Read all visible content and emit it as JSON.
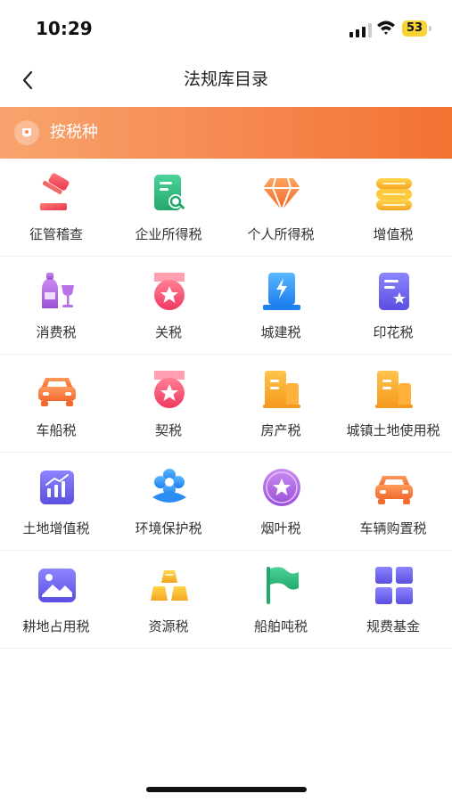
{
  "status": {
    "time": "10:29",
    "battery": "53"
  },
  "nav": {
    "title": "法规库目录"
  },
  "banner": {
    "label": "按税种"
  },
  "grid": {
    "items": [
      {
        "label": "征管稽查",
        "icon": "gavel-icon"
      },
      {
        "label": "企业所得税",
        "icon": "document-search-icon"
      },
      {
        "label": "个人所得税",
        "icon": "diamond-icon"
      },
      {
        "label": "增值税",
        "icon": "coin-stack-icon"
      },
      {
        "label": "消费税",
        "icon": "wine-bottle-icon"
      },
      {
        "label": "关税",
        "icon": "medal-icon"
      },
      {
        "label": "城建税",
        "icon": "building-lightning-icon"
      },
      {
        "label": "印花税",
        "icon": "stamp-document-icon"
      },
      {
        "label": "车船税",
        "icon": "car-icon"
      },
      {
        "label": "契税",
        "icon": "medal-icon"
      },
      {
        "label": "房产税",
        "icon": "buildings-icon"
      },
      {
        "label": "城镇土地使用税",
        "icon": "buildings-icon"
      },
      {
        "label": "土地增值税",
        "icon": "bar-chart-icon"
      },
      {
        "label": "环境保护税",
        "icon": "flower-icon"
      },
      {
        "label": "烟叶税",
        "icon": "star-circle-icon"
      },
      {
        "label": "车辆购置税",
        "icon": "car-icon"
      },
      {
        "label": "耕地占用税",
        "icon": "landscape-icon"
      },
      {
        "label": "资源税",
        "icon": "gold-bars-icon"
      },
      {
        "label": "船舶吨税",
        "icon": "flag-icon"
      },
      {
        "label": "规费基金",
        "icon": "grid-icon"
      }
    ]
  },
  "colors": {
    "banner_start": "#f8a46e",
    "banner_end": "#f27232",
    "text": "#333333"
  }
}
